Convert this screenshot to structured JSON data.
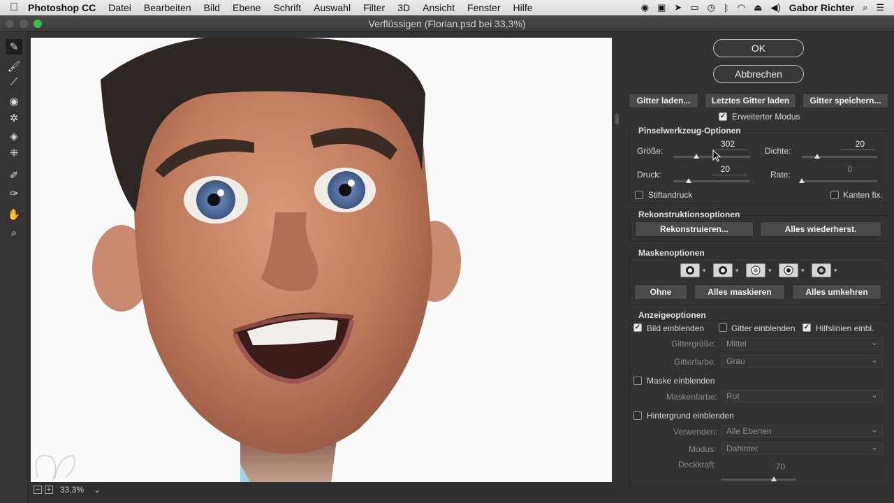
{
  "menubar": {
    "app": "Photoshop CC",
    "menus": [
      "Datei",
      "Bearbeiten",
      "Bild",
      "Ebene",
      "Schrift",
      "Auswahl",
      "Filter",
      "3D",
      "Ansicht",
      "Fenster",
      "Hilfe"
    ],
    "user": "Gabor Richter"
  },
  "window": {
    "title": "Verflüssigen (Florian.psd bei 33,3%)"
  },
  "statusbar": {
    "zoom": "33,3%"
  },
  "panel": {
    "ok": "OK",
    "cancel": "Abbrechen",
    "mesh": {
      "load": "Gitter laden...",
      "load_last": "Letztes Gitter laden",
      "save": "Gitter speichern..."
    },
    "advanced_mode": "Erweiterter Modus",
    "brush": {
      "title": "Pinselwerkzeug-Optionen",
      "size_label": "Größe:",
      "size": "302",
      "size_frac": 0.3,
      "density_label": "Dichte:",
      "density": "20",
      "density_frac": 0.2,
      "pressure_label": "Druck:",
      "pressure": "20",
      "pressure_frac": 0.2,
      "rate_label": "Rate:",
      "rate": "0",
      "rate_frac": 0.0,
      "stylus": "Stiftandruck",
      "pin_edges": "Kanten fix."
    },
    "reconstruct": {
      "title": "Rekonstruktionsoptionen",
      "reconstruct": "Rekonstruieren...",
      "restore_all": "Alles wiederherst."
    },
    "mask": {
      "title": "Maskenoptionen",
      "none": "Ohne",
      "mask_all": "Alles maskieren",
      "invert_all": "Alles umkehren"
    },
    "view": {
      "title": "Anzeigeoptionen",
      "show_image": "Bild einblenden",
      "show_mesh": "Gitter einblenden",
      "show_guides": "Hilfslinien einbl.",
      "mesh_size_label": "Gittergröße:",
      "mesh_size": "Mittel",
      "mesh_color_label": "Gitterfarbe:",
      "mesh_color": "Grau",
      "show_mask": "Maske einblenden",
      "mask_color_label": "Maskenfarbe:",
      "mask_color": "Rot",
      "show_backdrop": "Hintergrund einblenden",
      "use_label": "Verwenden:",
      "use": "Alle Ebenen",
      "mode_label": "Modus:",
      "mode": "Dahinter",
      "opacity_label": "Deckkraft:",
      "opacity": "70",
      "opacity_frac": 0.7
    }
  },
  "colors": {
    "accent": "#ececec",
    "panel_bg": "#323232"
  }
}
